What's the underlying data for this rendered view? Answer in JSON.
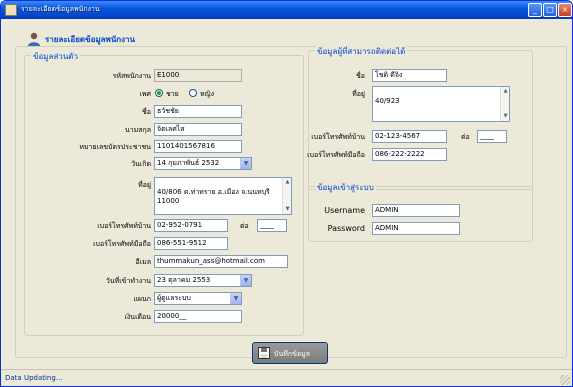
{
  "window": {
    "title": "รายละเอียดข้อมูลพนักงาน"
  },
  "header": {
    "title": "รายละเอียดข้อมูลพนักงาน"
  },
  "personal": {
    "legend": "ข้อมูลส่วนตัว",
    "emp_id_label": "รหัสพนักงาน",
    "emp_id": "E1000",
    "gender_label": "เพศ",
    "gender_male": "ชาย",
    "gender_female": "หญิง",
    "gender_selected": "male",
    "firstname_label": "ชื่อ",
    "firstname": "ธวัชชัย",
    "lastname_label": "นามสกุล",
    "lastname": "จิตเลศไส",
    "idcard_label": "หมายเลขบัตรประชาชน",
    "idcard": "1101401567816",
    "birthdate_label": "วันเกิด",
    "birthdate": "14 กุมภาพันธ์   2532",
    "address_label": "ที่อยู่",
    "address": "40/806 ต.ท่าทราย อ.เมือง จ.นนทบุรี\n11000",
    "homephone_label": "เบอร์โทรศัพท์บ้าน",
    "homephone": "02-952-0791",
    "ext_label": "ต่อ",
    "ext": "____",
    "mobile_label": "เบอร์โทรศัพท์มือถือ",
    "mobile": "086-551-9512",
    "email_label": "อีเมล",
    "email": "thummakun_ass@hotmail.com",
    "startdate_label": "วันที่เข้าทำงาน",
    "startdate": "23  ตุลาคม     2553",
    "department_label": "แผนก",
    "department": "ผู้ดูแลระบบ",
    "salary_label": "เงินเดือน",
    "salary": "20000__"
  },
  "contact": {
    "legend": "ข้อมูลผู้ที่สามารถติดต่อได้",
    "name_label": "ชื่อ",
    "name": "โชติ ดีจิง",
    "address_label": "ที่อยู่",
    "address": "40/923",
    "homephone_label": "เบอร์โทรศัพท์บ้าน",
    "homephone": "02-123-4567",
    "ext_label": "ต่อ",
    "ext": "____",
    "mobile_label": "เบอร์โทรศัพท์มือถือ",
    "mobile": "086-222-2222"
  },
  "login": {
    "legend": "ข้อมูลเข้าสู่ระบบ",
    "username_label": "Username",
    "username": "ADMIN",
    "password_label": "Password",
    "password": "ADMIN"
  },
  "save_button": {
    "label": "บันทึกข้อมูล"
  },
  "status": {
    "text": "Data Updating..."
  }
}
